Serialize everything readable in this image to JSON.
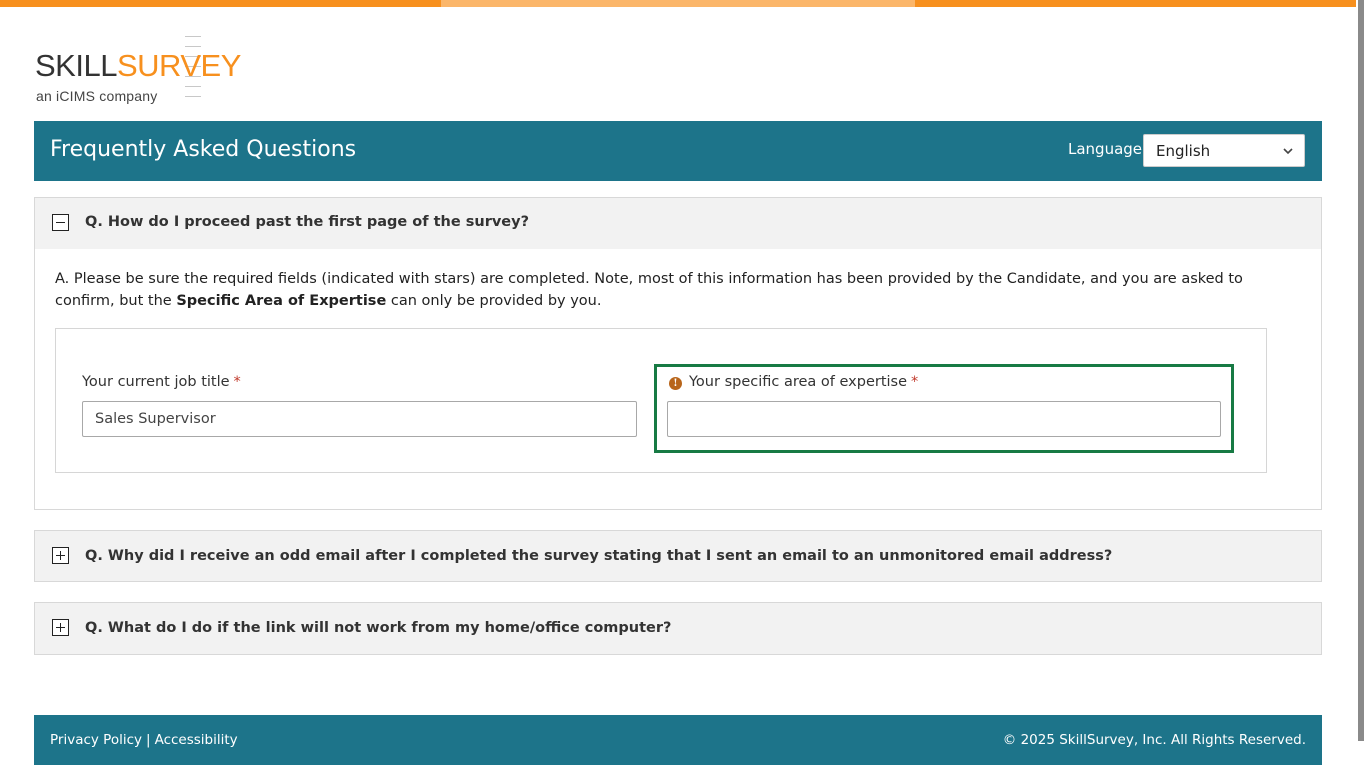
{
  "brand": {
    "logo_part1": "SKILL",
    "logo_part2": "SURVEY",
    "tagline": "an iCIMS company",
    "accent_color": "#f7901e",
    "header_color": "#1d748a"
  },
  "header": {
    "title": "Frequently Asked Questions",
    "language_label": "Language",
    "language_value": "English"
  },
  "faq": [
    {
      "question": "Q. How do I proceed past the first page of the survey?",
      "expanded": true,
      "answer_prefix": "A. Please be sure the required fields (indicated with stars) are completed. Note, most of this information has been provided by the Candidate, and you are asked to confirm, but the ",
      "answer_bold": "Specific Area of Expertise",
      "answer_suffix": " can only be provided by you.",
      "form": {
        "job_title_label": "Your current job title",
        "job_title_value": "Sales Supervisor",
        "expertise_label": "Your specific area of expertise",
        "expertise_value": "",
        "required_marker": "*"
      }
    },
    {
      "question": "Q. Why did I receive an odd email after I completed the survey stating that I sent an email to an unmonitored email address?",
      "expanded": false
    },
    {
      "question": "Q. What do I do if the link will not work from my home/office computer?",
      "expanded": false
    }
  ],
  "footer": {
    "privacy_label": "Privacy Policy",
    "separator": "|",
    "accessibility_label": "Accessibility",
    "copyright": "© 2025 SkillSurvey, Inc. All Rights Reserved."
  }
}
